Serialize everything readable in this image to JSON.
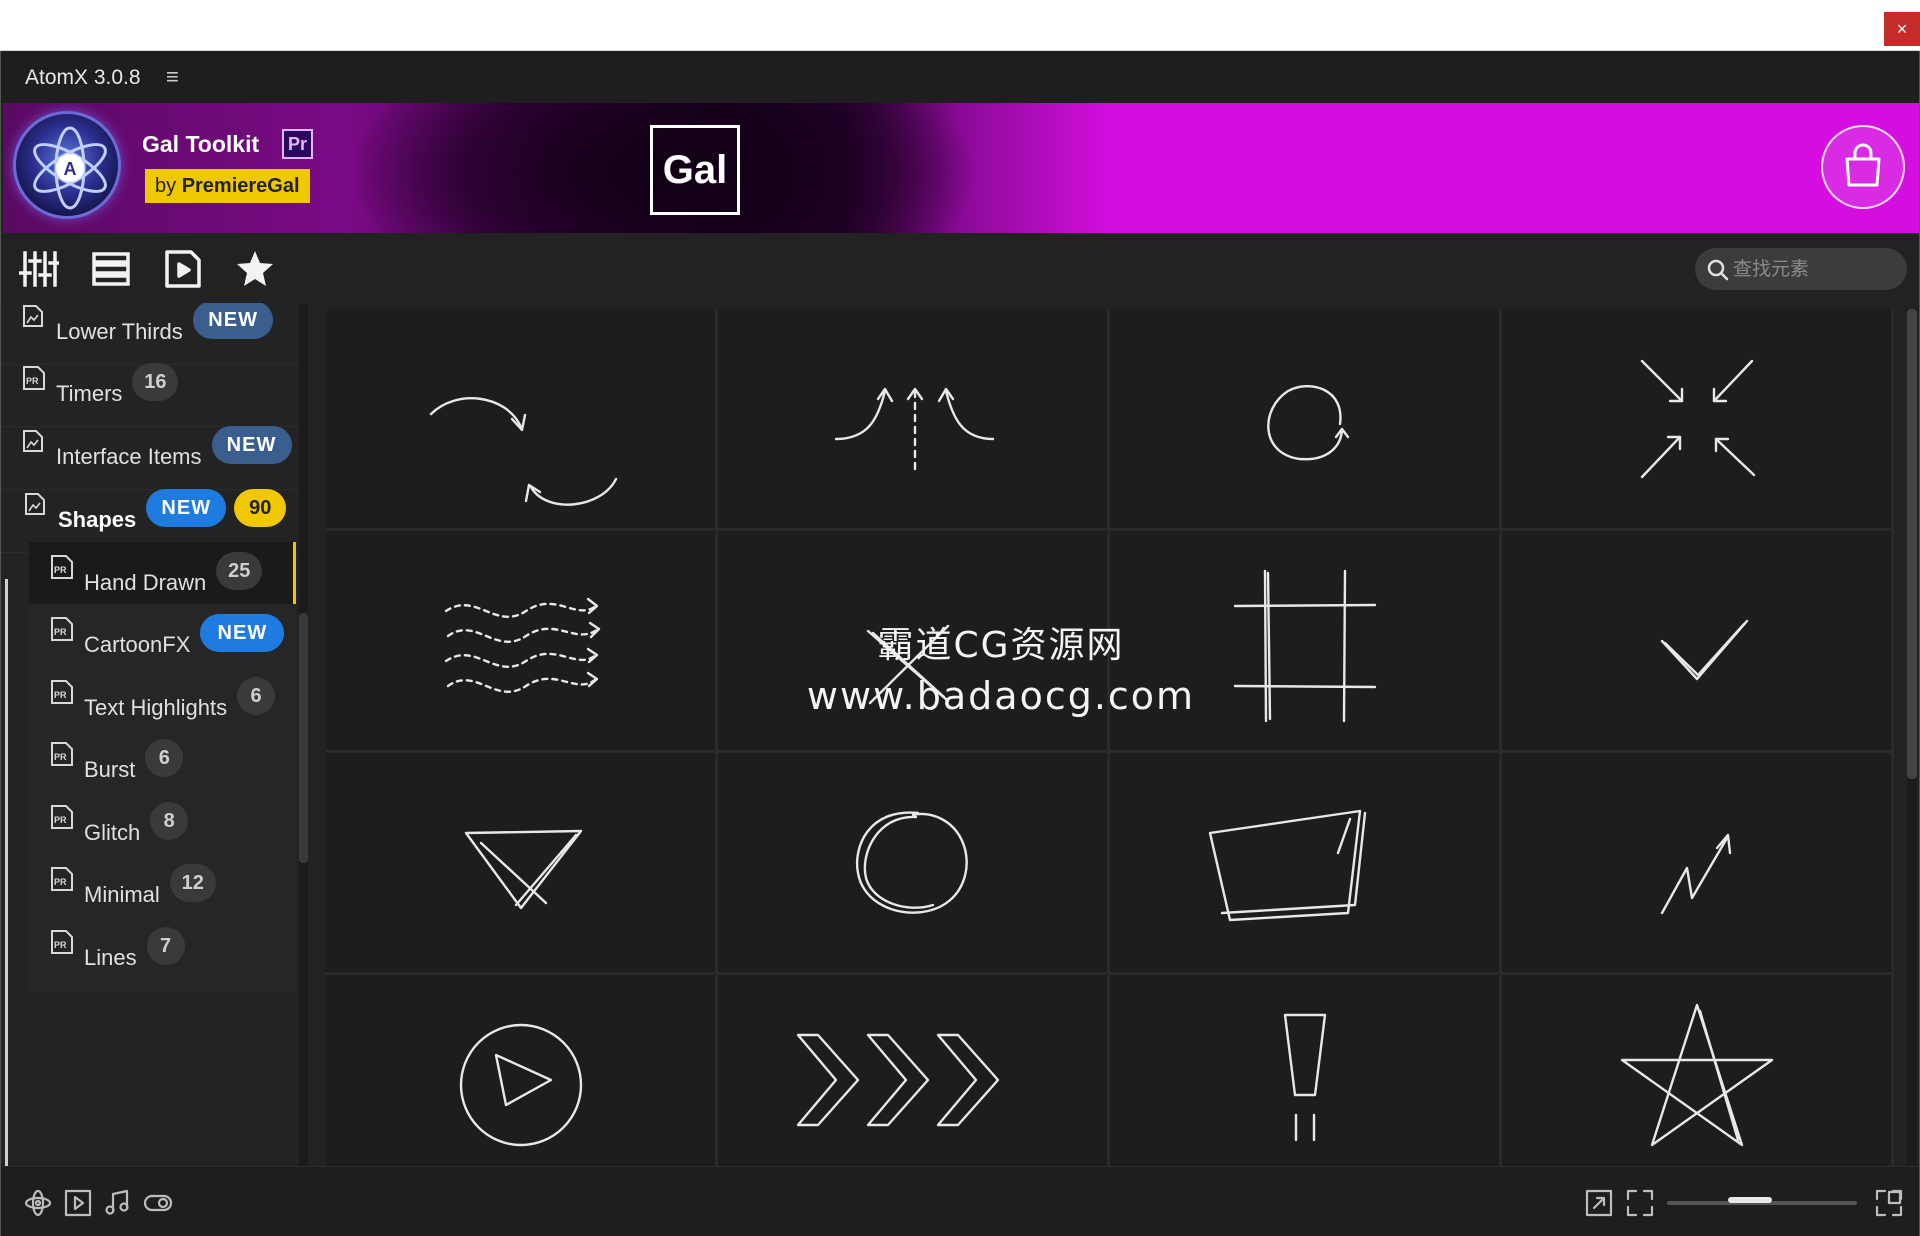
{
  "app": {
    "title": "AtomX 3.0.8",
    "menu_icon": "hamburger-menu-icon",
    "close_label": "×"
  },
  "banner": {
    "toolkit_name": "Gal Toolkit",
    "pr_badge": "Pr",
    "by_prefix": "by",
    "author": "PremiereGal",
    "gal_logo": "Gal",
    "accent_color": "#d40ee0",
    "author_badge_color": "#f0c800"
  },
  "toolbar": {
    "icons": [
      "sliders-icon",
      "list-icon",
      "media-file-icon",
      "star-icon"
    ],
    "search_placeholder": "查找元素"
  },
  "sidebar": {
    "items": [
      {
        "label": "Lower Thirds",
        "badge_new": "NEW"
      },
      {
        "label": "Timers",
        "count": "16"
      },
      {
        "label": "Interface Items",
        "badge_new": "NEW"
      },
      {
        "label": "Shapes",
        "badge_new": "NEW",
        "count": "90",
        "expanded": true
      },
      {
        "label": "Hand Drawn",
        "count": "25",
        "selected": true
      },
      {
        "label": "CartoonFX",
        "badge_new": "NEW"
      },
      {
        "label": "Text Highlights",
        "count": "6"
      },
      {
        "label": "Burst",
        "count": "6"
      },
      {
        "label": "Glitch",
        "count": "8"
      },
      {
        "label": "Minimal",
        "count": "12"
      },
      {
        "label": "Lines",
        "count": "7"
      }
    ]
  },
  "grid": {
    "columns": 4,
    "items": [
      "swap-arrows",
      "three-arrows-up",
      "circular-arrow",
      "arrows-inward",
      "wavy-arrows",
      "hand-drawn-x",
      "hash-square",
      "checkmark",
      "triangle-x",
      "scribble-circle",
      "box-outline",
      "zigzag-arrow",
      "play-circle",
      "chevrons",
      "exclamation",
      "star-outline"
    ]
  },
  "watermark": {
    "line1": "霸道CG资源网",
    "line2": "www.badaocg.com"
  },
  "statusbar": {
    "left_icons": [
      "atom-icon",
      "play-box-icon",
      "music-note-icon",
      "toggle-icon"
    ],
    "right_icons": [
      "export-icon",
      "fullscreen-icon",
      "dock-icon"
    ],
    "zoom_level": 0.42
  }
}
